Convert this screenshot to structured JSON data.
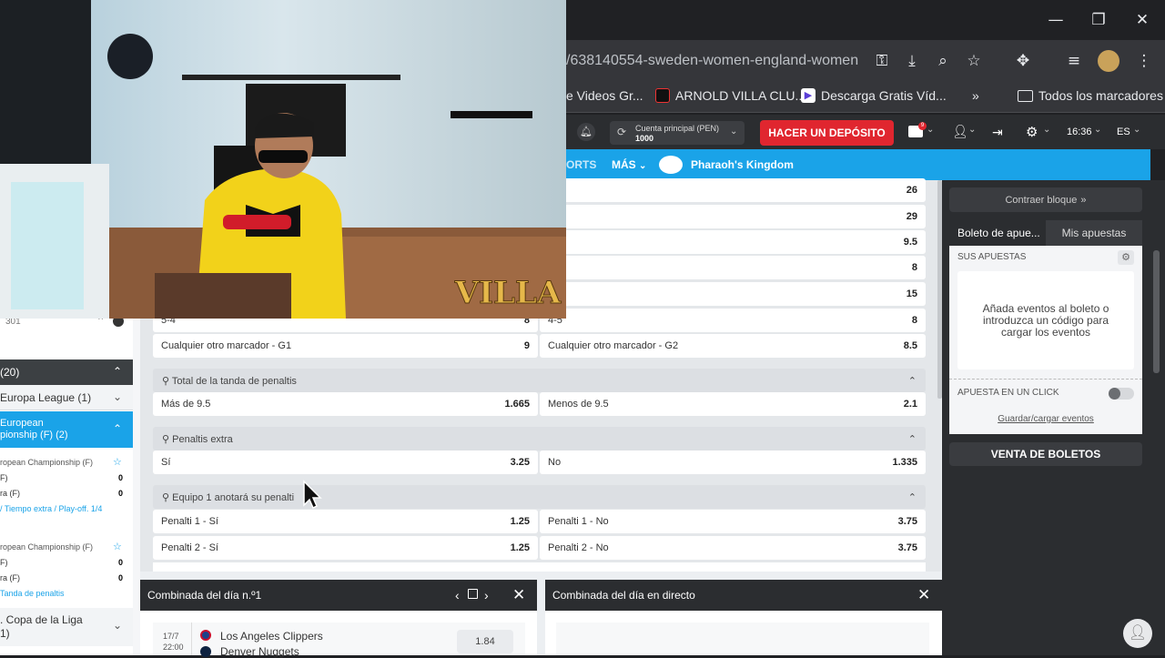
{
  "browser": {
    "url": "/638140554-sweden-women-england-women",
    "bookmarks": [
      "e Videos Gr...",
      "ARNOLD VILLA CLU...",
      "Descarga Gratis Víd...",
      "Todos los marcadores"
    ],
    "more_bookmarks": "»"
  },
  "header": {
    "account_label": "Cuenta principal (PEN)",
    "account_value": "1000",
    "deposit_button": "HACER UN DEPÓSITO",
    "mail_badge": "9",
    "time": "16:36",
    "language": "ES"
  },
  "nav": {
    "sports_partial": "ORTS",
    "more": "MÁS",
    "promo": "Pharaoh's Kingdom"
  },
  "left": {
    "count_text": "301",
    "section_title": "(20)",
    "europa": "Europa League (1)",
    "championship_line1": "European",
    "championship_line2": "pionship (F) (2)",
    "match1": {
      "league": "ropean Championship (F)",
      "team1": "F)",
      "score1": "0",
      "team2": "ra (F)",
      "score2": "0",
      "status": "/ Tiempo extra / Play-off. 1/4"
    },
    "match2": {
      "league": "ropean Championship (F)",
      "team1": "F)",
      "score1": "0",
      "team2": "ra (F)",
      "score2": "0",
      "status": "Tanda de penaltis"
    },
    "copa_line1": ". Copa de la Liga",
    "copa_line2": "1)"
  },
  "markets": {
    "top_rows": [
      {
        "right_val": "26"
      },
      {
        "right_val": "29"
      },
      {
        "right_val": "9.5"
      },
      {
        "right_val": "8"
      },
      {
        "right_val": "15"
      }
    ],
    "score_row": {
      "left": "5-4",
      "left_val": "8",
      "right": "4-5",
      "right_val": "8"
    },
    "other_row": {
      "left": "Cualquier otro marcador - G1",
      "left_val": "9",
      "right": "Cualquier otro marcador - G2",
      "right_val": "8.5"
    },
    "total_title": "Total de la tanda de penaltis",
    "total_row": {
      "left": "Más de 9.5",
      "left_val": "1.665",
      "right": "Menos de 9.5",
      "right_val": "2.1"
    },
    "extra_title": "Penaltis extra",
    "extra_row": {
      "left": "Sí",
      "left_val": "3.25",
      "right": "No",
      "right_val": "1.335"
    },
    "team1_title": "Equipo 1 anotará su penalti",
    "team1_rows": [
      {
        "left": "Penalti 1 - Sí",
        "left_val": "1.25",
        "right": "Penalti 1 - No",
        "right_val": "3.75"
      },
      {
        "left": "Penalti 2 - Sí",
        "left_val": "1.25",
        "right": "Penalti 2 - No",
        "right_val": "3.75"
      }
    ]
  },
  "betslip": {
    "collapse": "Contraer bloque",
    "tab_active": "Boleto de apue...",
    "tab_other": "Mis apuestas",
    "section": "SUS APUESTAS",
    "empty_text": "Añada eventos al boleto o introduzca un código para cargar los eventos",
    "one_click": "APUESTA EN UN CLICK",
    "save_load": "Guardar/cargar eventos",
    "tickets": "VENTA DE BOLETOS"
  },
  "bottom": {
    "combo1_title": "Combinada del día n.º1",
    "combo1_date": "17/7",
    "combo1_time": "22:00",
    "team_a": "Los Angeles Clippers",
    "team_b": "Denver Nuggets",
    "odd": "1.84",
    "combo2_title": "Combinada del día en directo"
  },
  "webcam": {
    "overlay_text": "VILLA"
  },
  "colors": {
    "accent_blue": "#1aa3e8",
    "deposit_red": "#e0262f",
    "dark_bg": "#2b2d30"
  }
}
